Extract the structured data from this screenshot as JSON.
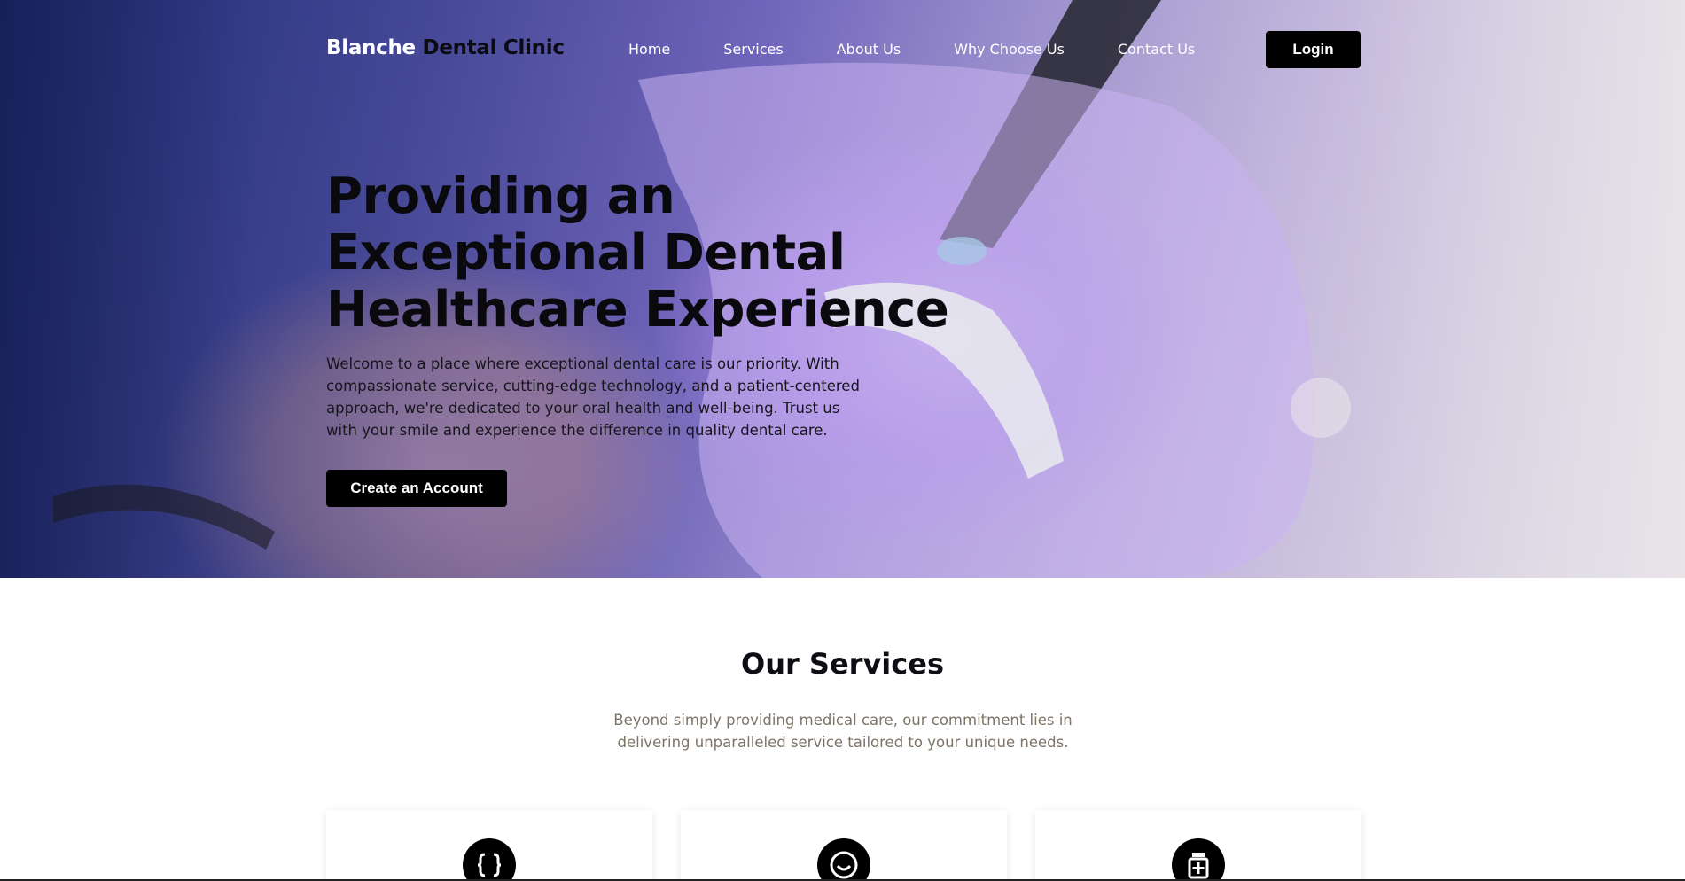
{
  "header": {
    "brand_part1": "Blanche",
    "brand_part2": "Dental Clinic",
    "nav": [
      {
        "label": "Home"
      },
      {
        "label": "Services"
      },
      {
        "label": "About Us"
      },
      {
        "label": "Why Choose Us"
      },
      {
        "label": "Contact Us"
      }
    ],
    "login_label": "Login"
  },
  "hero": {
    "title": "Providing an Exceptional Dental Healthcare Experience",
    "text": "Welcome to a place where exceptional dental care is our priority. With compassionate service, cutting-edge technology, and a patient-centered approach, we're dedicated to your oral health and well-being. Trust us with your smile and experience the difference in quality dental care.",
    "cta_label": "Create an Account"
  },
  "services": {
    "title": "Our Services",
    "subtitle": "Beyond simply providing medical care, our commitment lies in delivering unparalleled service tailored to your unique needs.",
    "cards": [
      {
        "icon": "braces-icon"
      },
      {
        "icon": "smile-icon"
      },
      {
        "icon": "medicine-bottle-icon"
      }
    ]
  },
  "colors": {
    "button_bg": "#000000",
    "subtitle_text": "#7d7468"
  }
}
